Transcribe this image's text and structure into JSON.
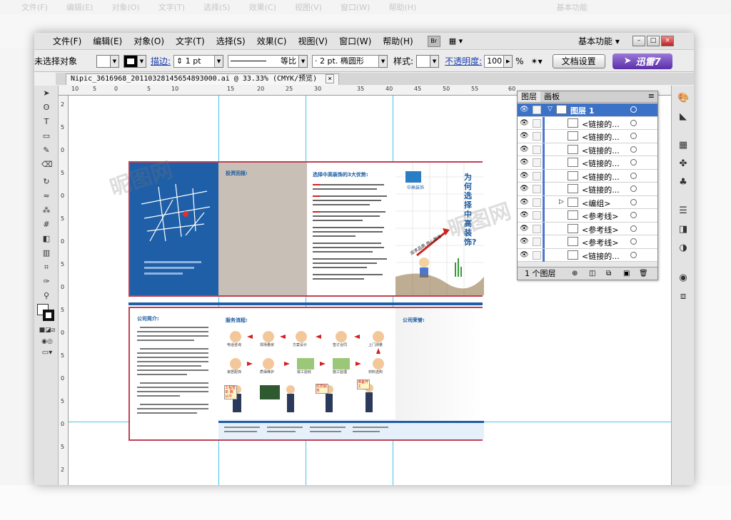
{
  "ghost": {
    "menus": [
      "文件(F)",
      "编辑(E)",
      "对象(O)",
      "文字(T)",
      "选择(S)",
      "效果(C)",
      "视图(V)",
      "窗口(W)",
      "帮助(H)"
    ],
    "workspace": "基本功能"
  },
  "menubar": {
    "items": [
      "文件(F)",
      "编辑(E)",
      "对象(O)",
      "文字(T)",
      "选择(S)",
      "效果(C)",
      "视图(V)",
      "窗口(W)",
      "帮助(H)"
    ],
    "br_label": "Br",
    "workspace": "基本功能"
  },
  "control_bar": {
    "selection": "未选择对象",
    "stroke_label": "描边:",
    "stroke_weight": "1 pt",
    "profile": "等比",
    "brush": "2 pt. 椭圆形",
    "style_label": "样式:",
    "opacity_label": "不透明度:",
    "opacity_value": "100",
    "opacity_unit": "%",
    "doc_setup_button": "文档设置",
    "xunlei_label": "迅雷7"
  },
  "document_tab": {
    "title": "Nipic_3616968_20110328145654893000.ai @ 33.33% (CMYK/预览)",
    "close": "×"
  },
  "ruler": {
    "h_ticks": [
      "10",
      "5",
      "0",
      "5",
      "10",
      "15",
      "20",
      "25",
      "30",
      "35",
      "40",
      "45",
      "50",
      "55",
      "60"
    ],
    "v_ticks": [
      "2",
      "5",
      "0",
      "5",
      "0",
      "5",
      "0",
      "5",
      "0",
      "5",
      "0",
      "5",
      "0",
      "5",
      "0",
      "5",
      "2"
    ]
  },
  "brochure": {
    "top_panel2_title": "投资回报:",
    "top_panel3_title": "选择中高装饰的3大优势:",
    "top_panel4_vertical": "为何选择中高装饰?",
    "top_panel4_slogan": "追求品质 用心服务",
    "top_panel4_logo": "中高装饰",
    "bottom_panel1_title": "公司简介:",
    "bottom_panel2_title": "服务流程:",
    "bottom_panel3_title": "公司荣誉:",
    "flow_labels": [
      "电话咨询",
      "现场量房",
      "方案设计",
      "签订合同",
      "上门测量",
      "材料选购",
      "施工监理",
      "竣工验收",
      "质保维护",
      "家居配饰"
    ],
    "sign1": "工程签单 确认中",
    "sign2": "优质服务",
    "sign3": "准备开工"
  },
  "layers_panel": {
    "tabs": [
      "图层",
      "画板"
    ],
    "rows": [
      {
        "name": "图层 1",
        "type": "layer"
      },
      {
        "name": "<链接的...",
        "type": "item"
      },
      {
        "name": "<链接的...",
        "type": "item"
      },
      {
        "name": "<链接的...",
        "type": "item"
      },
      {
        "name": "<链接的...",
        "type": "item"
      },
      {
        "name": "<链接的...",
        "type": "item"
      },
      {
        "name": "<链接的...",
        "type": "item"
      },
      {
        "name": "<编组>",
        "type": "group"
      },
      {
        "name": "<参考线>",
        "type": "item"
      },
      {
        "name": "<参考线>",
        "type": "item"
      },
      {
        "name": "<参考线>",
        "type": "item"
      },
      {
        "name": "<链接的...",
        "type": "item"
      }
    ],
    "footer": "1 个图层"
  },
  "colors": {
    "accent_blue": "#1b5aa0",
    "spread_border": "#c04055",
    "guide": "#42c7e8",
    "panel_brown": "#c8bfb6",
    "layer_color": "#4a78d0"
  }
}
